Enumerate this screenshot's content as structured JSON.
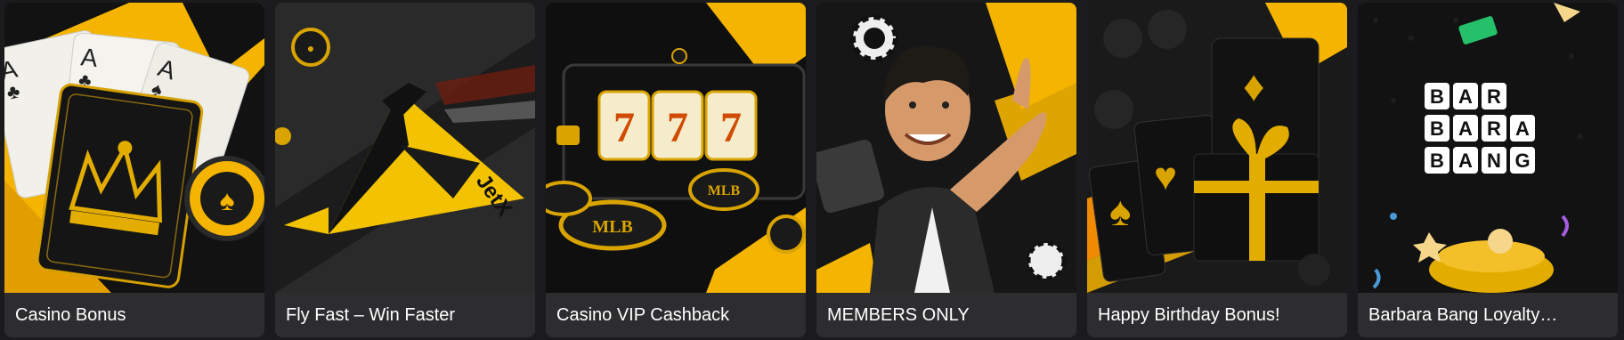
{
  "cards": [
    {
      "title": "Casino Bonus",
      "icon": "casino-cards-crown-icon"
    },
    {
      "title": "Fly Fast – Win Faster",
      "icon": "jetx-plane-icon",
      "logo_text": "JetX"
    },
    {
      "title": "Casino VIP Cashback",
      "icon": "slot-machine-777-icon",
      "reel_digits": [
        "7",
        "7",
        "7"
      ],
      "chip_text": "MLB"
    },
    {
      "title": "MEMBERS ONLY",
      "icon": "pointing-man-icon"
    },
    {
      "title": "Happy Birthday Bonus!",
      "icon": "gift-box-icon"
    },
    {
      "title": "Barbara Bang Loyalty…",
      "icon": "barbara-bang-logo",
      "logo_lines": [
        "BAR",
        "BARA",
        "BANG"
      ]
    }
  ],
  "colors": {
    "accent": "#f5b800",
    "card_bg": "#2d2d30",
    "page_bg": "#1b1b1d"
  }
}
